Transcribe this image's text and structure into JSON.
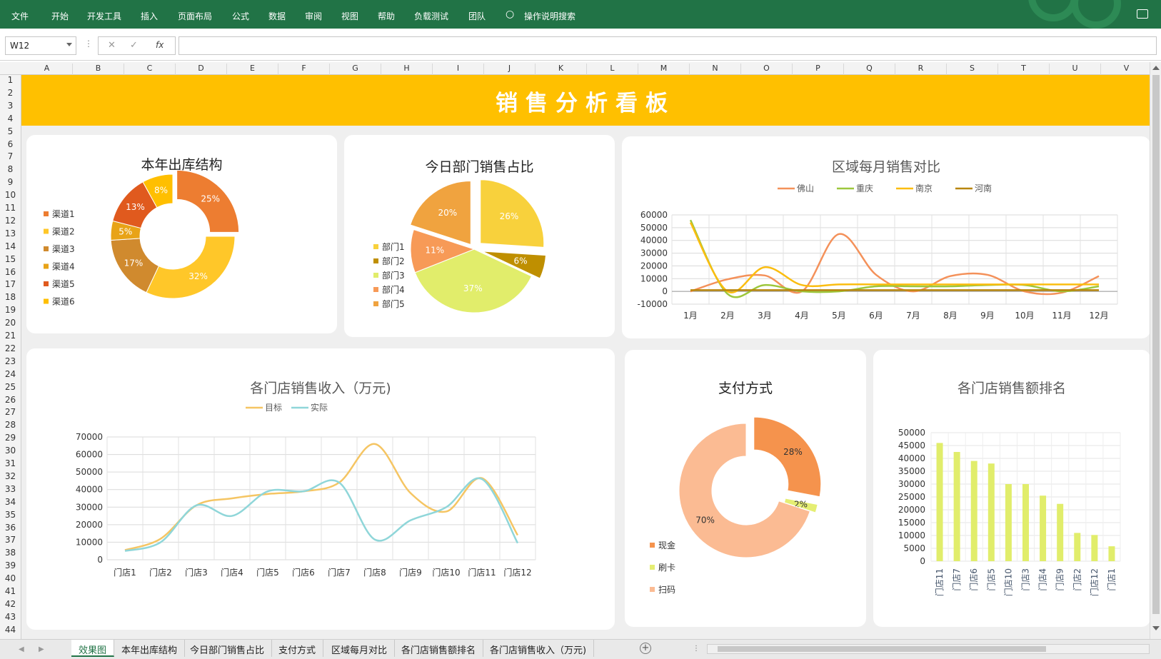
{
  "ribbon": {
    "tabs": [
      "文件",
      "开始",
      "开发工具",
      "插入",
      "页面布局",
      "公式",
      "数据",
      "审阅",
      "视图",
      "帮助",
      "负载测试",
      "团队"
    ],
    "search_label": "操作说明搜索",
    "bg_color": "#217346"
  },
  "formula_bar": {
    "name_box": "W12",
    "fx": "fx",
    "cancel": "✕",
    "confirm": "✓",
    "value": ""
  },
  "columns": [
    "A",
    "B",
    "C",
    "D",
    "E",
    "F",
    "G",
    "H",
    "I",
    "J",
    "K",
    "L",
    "M",
    "N",
    "O",
    "P",
    "Q",
    "R",
    "S",
    "T",
    "U",
    "V"
  ],
  "rows": [
    "1",
    "2",
    "3",
    "4",
    "5",
    "6",
    "7",
    "8",
    "9",
    "10",
    "11",
    "12",
    "13",
    "14",
    "15",
    "16",
    "17",
    "18",
    "19",
    "20",
    "21",
    "22",
    "23",
    "24",
    "25",
    "26",
    "27",
    "28",
    "29",
    "30",
    "31",
    "32",
    "33",
    "34",
    "35",
    "36",
    "37",
    "38",
    "39",
    "40",
    "41",
    "42",
    "43",
    "44"
  ],
  "banner": {
    "title": "销售分析看板",
    "color": "#ffc000"
  },
  "chart_data": [
    {
      "id": "warehouse",
      "type": "pie",
      "title": "本年出库结构",
      "donut": true,
      "categories": [
        "渠道1",
        "渠道2",
        "渠道3",
        "渠道4",
        "渠道5",
        "渠道6"
      ],
      "values": [
        25,
        32,
        17,
        5,
        13,
        8
      ],
      "labels": [
        "25%",
        "32%",
        "17%",
        "5%",
        "13%",
        "8%"
      ],
      "colors": [
        "#ed7d31",
        "#ffc729",
        "#d08a2e",
        "#e8a317",
        "#e05a1e",
        "#ffbf00"
      ],
      "legend_position": "left"
    },
    {
      "id": "dept",
      "type": "pie",
      "title": "今日部门销售占比",
      "donut": false,
      "categories": [
        "部门1",
        "部门2",
        "部门3",
        "部门4",
        "部门5"
      ],
      "values": [
        26,
        6,
        37,
        11,
        20
      ],
      "labels": [
        "26%",
        "6%",
        "37%",
        "11%",
        "20%"
      ],
      "colors": [
        "#f8d13c",
        "#bf8f00",
        "#e1ed6b",
        "#f79a57",
        "#f0a33f"
      ],
      "legend_position": "left"
    },
    {
      "id": "region",
      "type": "line",
      "title": "区域每月销售对比",
      "categories": [
        "1月",
        "2月",
        "3月",
        "4月",
        "5月",
        "6月",
        "7月",
        "8月",
        "9月",
        "10月",
        "11月",
        "12月"
      ],
      "series": [
        {
          "name": "佛山",
          "color": "#f4915a",
          "values": [
            0,
            9500,
            12500,
            0,
            45000,
            13000,
            0,
            12000,
            13000,
            0,
            -1000,
            12000
          ]
        },
        {
          "name": "重庆",
          "color": "#9dc73c",
          "values": [
            56000,
            -2000,
            5000,
            0,
            0,
            4000,
            4000,
            4000,
            5000,
            5000,
            0,
            4000
          ]
        },
        {
          "name": "南京",
          "color": "#fbbd10",
          "values": [
            54000,
            0,
            19000,
            5000,
            5500,
            5500,
            5500,
            5500,
            5500,
            5500,
            5500,
            5500
          ]
        },
        {
          "name": "河南",
          "color": "#b8860b",
          "values": [
            1000,
            1000,
            1000,
            1000,
            1000,
            1000,
            1000,
            1000,
            1000,
            1000,
            1000,
            1000
          ]
        }
      ],
      "yticks": [
        "60000",
        "50000",
        "40000",
        "30000",
        "20000",
        "10000",
        "0",
        "-10000"
      ],
      "ylim": [
        -10000,
        60000
      ],
      "grid": true,
      "legend_position": "top"
    },
    {
      "id": "store_income",
      "type": "line",
      "title": "各门店销售收入（万元)",
      "categories": [
        "门店1",
        "门店2",
        "门店3",
        "门店4",
        "门店5",
        "门店6",
        "门店7",
        "门店8",
        "门店9",
        "门店10",
        "门店11",
        "门店12"
      ],
      "series": [
        {
          "name": "目标",
          "color": "#f5c563",
          "values": [
            5500,
            12000,
            31000,
            35000,
            37500,
            39000,
            44000,
            66000,
            38000,
            27500,
            46500,
            14000
          ]
        },
        {
          "name": "实际",
          "color": "#8fd6d9",
          "values": [
            5000,
            10000,
            31000,
            25000,
            39000,
            39000,
            44000,
            11500,
            22500,
            30000,
            46000,
            9500
          ]
        }
      ],
      "yticks": [
        "70000",
        "60000",
        "50000",
        "40000",
        "30000",
        "20000",
        "10000",
        "0"
      ],
      "ylim": [
        0,
        70000
      ],
      "grid": true,
      "legend_position": "top"
    },
    {
      "id": "payment",
      "type": "pie",
      "title": "支付方式",
      "donut": true,
      "categories": [
        "现金",
        "刷卡",
        "扫码"
      ],
      "values": [
        28,
        2,
        70
      ],
      "labels": [
        "28%",
        "2%",
        "70%"
      ],
      "colors": [
        "#f5934d",
        "#e5ee73",
        "#fbbb93"
      ],
      "legend_position": "left"
    },
    {
      "id": "ranking",
      "type": "bar",
      "title": "各门店销售额排名",
      "categories": [
        "门店11",
        "门店7",
        "门店6",
        "门店5",
        "门店10",
        "门店3",
        "门店4",
        "门店9",
        "门店2",
        "门店12",
        "门店1"
      ],
      "values": [
        46000,
        42500,
        39000,
        38000,
        30000,
        30000,
        25500,
        22300,
        11000,
        10200,
        5800
      ],
      "color": "#e1ed6b",
      "yticks": [
        "50000",
        "45000",
        "40000",
        "35000",
        "30000",
        "25000",
        "20000",
        "15000",
        "10000",
        "5000",
        "0"
      ],
      "ylim": [
        0,
        50000
      ],
      "grid": true
    }
  ],
  "sheet_tabs": [
    "效果图",
    "本年出库结构",
    "今日部门销售占比",
    "支付方式",
    "区域每月对比",
    "各门店销售额排名",
    "各门店销售收入（万元)"
  ],
  "active_sheet": "效果图"
}
